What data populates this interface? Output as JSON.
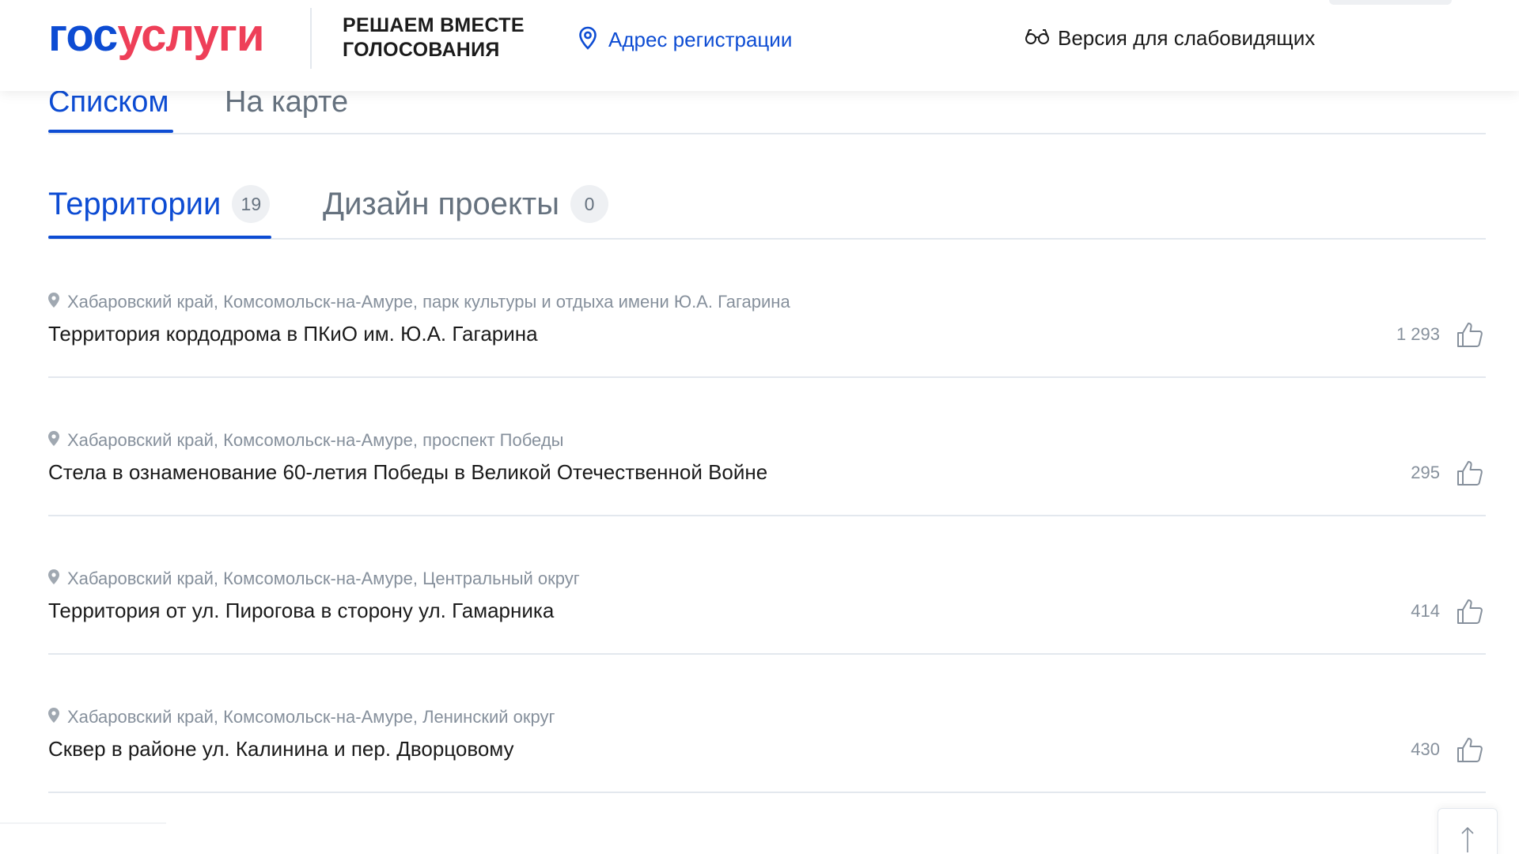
{
  "header": {
    "logo_gos": "гос",
    "logo_uslugi": "услуги",
    "slogan_line1": "РЕШАЕМ ВМЕСТЕ",
    "slogan_line2": "ГОЛОСОВАНИЯ",
    "address_label": "Адрес регистрации",
    "vision_label": "Версия для слабовидящих",
    "address_icon": "location-pin-icon",
    "vision_icon": "glasses-icon"
  },
  "view_tabs": {
    "list_label": "Списком",
    "map_label": "На карте",
    "active": "list"
  },
  "category_tabs": {
    "territories_label": "Территории",
    "territories_count": "19",
    "designs_label": "Дизайн проекты",
    "designs_count": "0",
    "active": "territories"
  },
  "items": [
    {
      "location": "Хабаровский край, Комсомольск-на-Амуре, парк культуры и отдыха имени Ю.А. Гагарина",
      "title": "Территория кордодрома в ПКиО им. Ю.А. Гагарина",
      "votes": "1 293"
    },
    {
      "location": "Хабаровский край, Комсомольск-на-Амуре, проспект Победы",
      "title": "Стела в ознаменование 60-летия Победы в Великой Отечественной Войне",
      "votes": "295"
    },
    {
      "location": "Хабаровский край, Комсомольск-на-Амуре, Центральный округ",
      "title": "Территория от ул. Пирогова в сторону ул. Гамарника",
      "votes": "414"
    },
    {
      "location": "Хабаровский край, Комсомольск-на-Амуре, Ленинский округ",
      "title": "Сквер в районе ул. Калинина и пер. Дворцовому",
      "votes": "430"
    }
  ],
  "colors": {
    "brand_blue": "#0d4cd3",
    "brand_red": "#ee3f58",
    "muted_text": "#86909c",
    "divider": "#e3e8ee"
  },
  "icons": {
    "like": "thumbs-up-icon",
    "scroll_top": "arrow-up-icon"
  }
}
